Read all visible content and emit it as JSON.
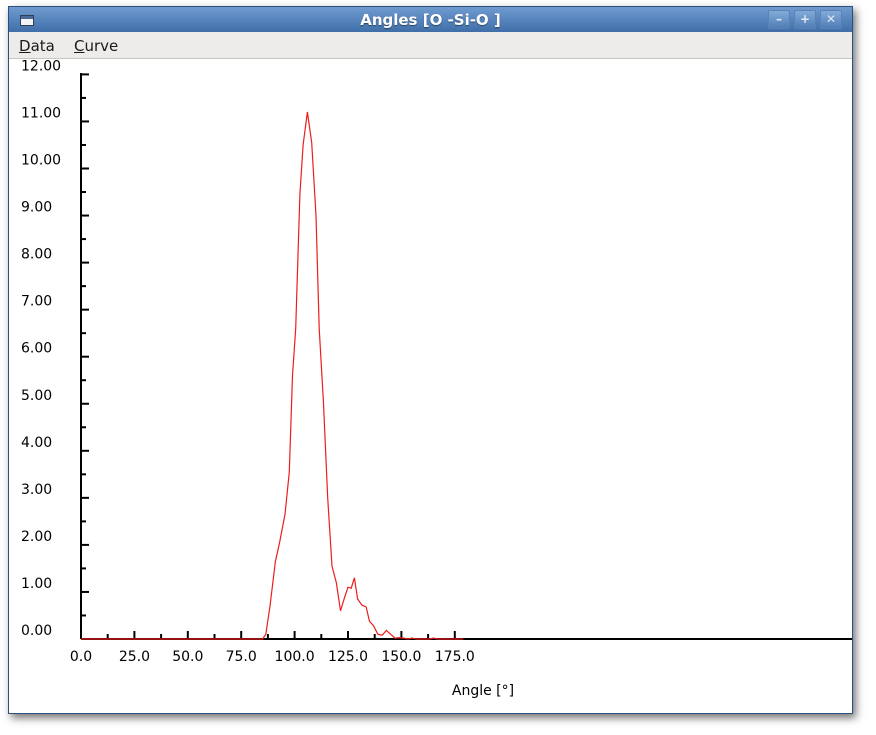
{
  "window": {
    "title": "Angles [O -Si-O ]",
    "minimize_label": "–",
    "maximize_label": "+",
    "close_label": "✕"
  },
  "menu": {
    "items": [
      {
        "mnemonic": "D",
        "rest": "ata"
      },
      {
        "mnemonic": "C",
        "rest": "urve"
      }
    ]
  },
  "chart_data": {
    "type": "line",
    "title": "",
    "xlabel": "Angle [°]",
    "ylabel": "",
    "xlim": [
      0,
      180
    ],
    "ylim": [
      0,
      12
    ],
    "x_ticks": [
      "0.0",
      "25.0",
      "50.0",
      "75.0",
      "100.0",
      "125.0",
      "150.0",
      "175.0"
    ],
    "y_ticks": [
      "0.00",
      "1.00",
      "2.00",
      "3.00",
      "4.00",
      "5.00",
      "6.00",
      "7.00",
      "8.00",
      "9.00",
      "10.00",
      "11.00",
      "12.00"
    ],
    "grid": false,
    "series": [
      {
        "color": "#ee1c1c",
        "x": [
          0,
          85,
          86.5,
          88.5,
          91,
          93,
          95.5,
          97.5,
          99,
          100.5,
          102.5,
          104,
          106,
          108,
          110,
          111.5,
          113.5,
          115.5,
          117.5,
          119.5,
          121.5,
          123.5,
          125,
          126.5,
          128,
          129.5,
          131.5,
          133.5,
          135,
          137,
          139,
          141,
          143,
          145,
          147,
          149,
          151,
          153,
          155,
          157,
          159,
          161,
          163,
          165,
          167,
          169,
          171,
          173,
          175,
          177,
          179
        ],
        "y": [
          0,
          0,
          0.1,
          0.7,
          1.65,
          2.05,
          2.65,
          3.55,
          5.6,
          6.6,
          9.45,
          10.5,
          11.2,
          10.55,
          9.0,
          6.6,
          5.05,
          3.0,
          1.55,
          1.2,
          0.6,
          0.9,
          1.1,
          1.08,
          1.3,
          0.85,
          0.72,
          0.68,
          0.38,
          0.28,
          0.1,
          0.08,
          0.18,
          0.1,
          0.02,
          0.03,
          0.02,
          0.0,
          0.02,
          0.0,
          0.0,
          0.0,
          0.0,
          0.02,
          0.0,
          0.0,
          0.0,
          0.0,
          0.0,
          0.0,
          0.0
        ]
      }
    ]
  }
}
